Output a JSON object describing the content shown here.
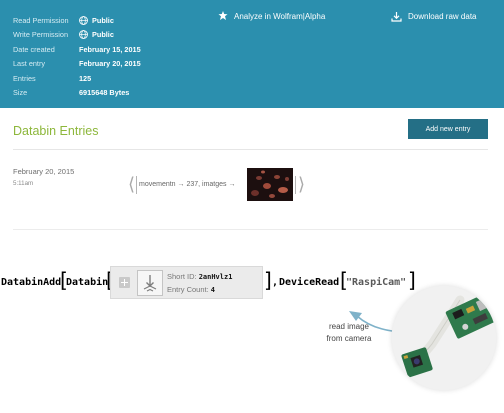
{
  "header": {
    "meta": [
      {
        "label": "Read Permission",
        "value": "Public",
        "icon": "globe-icon"
      },
      {
        "label": "Write Permission",
        "value": "Public",
        "icon": "globe-icon"
      },
      {
        "label": "Date created",
        "value": "February 15, 2015"
      },
      {
        "label": "Last entry",
        "value": "February 20, 2015"
      },
      {
        "label": "Entries",
        "value": "125"
      },
      {
        "label": "Size",
        "value": "6915648 Bytes"
      }
    ],
    "analyze_label": "Analyze in Wolfram|Alpha",
    "download_label": "Download raw data",
    "colors": {
      "background": "#2b8fae"
    }
  },
  "entries": {
    "title": "Databin Entries",
    "add_button": "Add new entry",
    "items": [
      {
        "date": "February 20, 2015",
        "time": "5:11am",
        "association": "movementn → 237, imatges →"
      }
    ]
  },
  "code": {
    "fn": "DatabinAdd",
    "databin": "Databin",
    "short_id_label": "Short ID:",
    "short_id_value": "2anHvlz1",
    "entry_count_label": "Entry Count:",
    "entry_count_value": "4",
    "comma": ",",
    "device_read": "DeviceRead",
    "device_arg": "\"RaspiCam\""
  },
  "caption": {
    "line1": "read image",
    "line2": "from camera"
  }
}
